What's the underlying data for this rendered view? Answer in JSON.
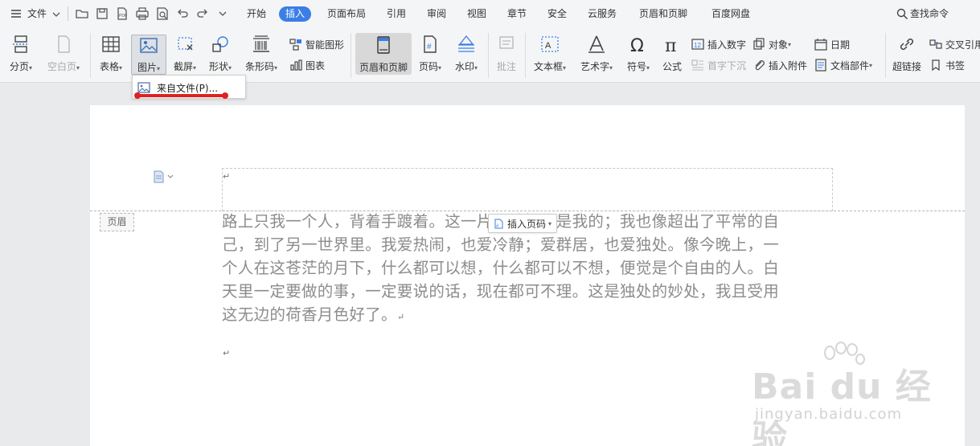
{
  "menubar": {
    "file_label": "文件",
    "tabs": [
      "开始",
      "插入",
      "页面布局",
      "引用",
      "审阅",
      "视图",
      "章节",
      "安全",
      "云服务",
      "页眉和页脚",
      "百度网盘"
    ],
    "active_tab": "插入",
    "search_label": "查找命令"
  },
  "ribbon": {
    "page_break": "分页",
    "blank_page": "空白页",
    "table": "表格",
    "picture": "图片",
    "screenshot": "截屏",
    "shapes": "形状",
    "barcode": "条形码",
    "smart_art": "智能图形",
    "chart": "图表",
    "header_footer": "页眉和页脚",
    "page_number": "页码",
    "watermark": "水印",
    "comment": "批注",
    "text_box": "文本框",
    "word_art": "艺术字",
    "symbol": "符号",
    "formula": "公式",
    "insert_number": "插入数字",
    "drop_cap": "首字下沉",
    "object": "对象",
    "insert_attachment": "插入附件",
    "date": "日期",
    "doc_parts": "文档部件",
    "hyperlink": "超链接",
    "cross_ref": "交叉引用",
    "bookmark": "书签"
  },
  "dropdown": {
    "from_file": "来自文件(P)..."
  },
  "page": {
    "header_tag": "页眉",
    "insert_page_number": "插入页码",
    "paragraph_mark": "↵",
    "body_lines": [
      "路上只我一个人，背着手踱着。这一片天地好像是我的；我也像超出了平常的自",
      "己，到了另一世界里。我爱热闹，也爱冷静；爱群居，也爱独处。像今晚上，一",
      "个人在这苍茫的月下，什么都可以想，什么都可以不想，便觉是个自由的人。白",
      "天里一定要做的事，一定要说的话，现在都可不理。这是独处的妙处，我且受用",
      "这无边的荷香月色好了。"
    ]
  },
  "watermark": {
    "main": "Bai du 经验",
    "sub": "jingyan.baidu.com"
  },
  "colors": {
    "accent": "#3a7ee6",
    "highlight_red": "#e02020"
  }
}
